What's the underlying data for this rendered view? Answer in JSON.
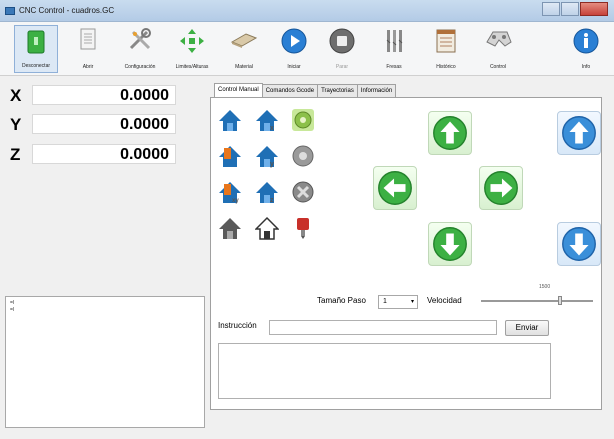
{
  "window": {
    "title": "CNC Control - cuadros.GC"
  },
  "toolbar": {
    "items": [
      {
        "label": "Desconectar",
        "icon": "disconnect-icon"
      },
      {
        "label": "Abrir",
        "icon": "open-file-icon"
      },
      {
        "label": "Configuración",
        "icon": "settings-tools-icon"
      },
      {
        "label": "Limites/Alturas",
        "icon": "limits-arrows-icon"
      },
      {
        "label": "Material",
        "icon": "material-sheet-icon"
      },
      {
        "label": "Iniciar",
        "icon": "play-icon"
      },
      {
        "label": "Parar",
        "icon": "stop-icon"
      },
      {
        "label": "Fresas",
        "icon": "milling-bits-icon"
      },
      {
        "label": "Histórico",
        "icon": "history-notebook-icon"
      },
      {
        "label": "Control",
        "icon": "gamepad-icon"
      },
      {
        "label": "Info",
        "icon": "info-icon"
      }
    ]
  },
  "coords": [
    {
      "axis": "X",
      "value": "0.0000"
    },
    {
      "axis": "Y",
      "value": "0.0000"
    },
    {
      "axis": "Z",
      "value": "0.0000"
    }
  ],
  "log": {
    "lines": [
      "=I",
      "=I"
    ]
  },
  "tabs": [
    {
      "label": "Control Manual",
      "active": true
    },
    {
      "label": "Comandos Gcode",
      "active": false
    },
    {
      "label": "Trayectorias",
      "active": false
    },
    {
      "label": "Información",
      "active": false
    }
  ],
  "manual": {
    "step_label": "Tamaño Paso",
    "step_value": "1",
    "speed_label": "Velocidad",
    "speed_value": "1500",
    "instruction_label": "Instrucción",
    "instruction_value": "",
    "send_label": "Enviar"
  },
  "colors": {
    "jog_green": "#3cb043",
    "jog_blue": "#3a8fd9",
    "home_blue": "#1f6fb5",
    "home_orange": "#e8761c"
  }
}
